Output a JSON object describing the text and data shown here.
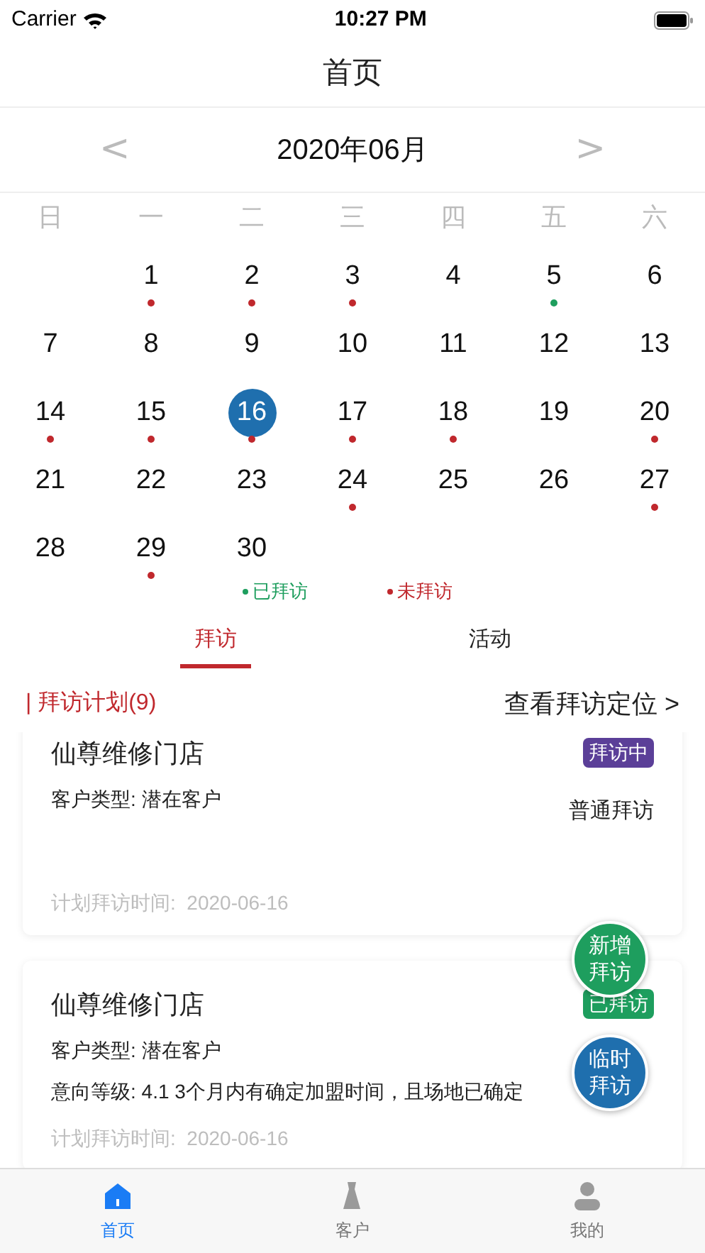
{
  "status_bar": {
    "carrier": "Carrier",
    "time": "10:27 PM"
  },
  "nav": {
    "title": "首页"
  },
  "calendar": {
    "month": "2020年06月",
    "prev": "<",
    "next": ">",
    "weekdays": [
      "日",
      "一",
      "二",
      "三",
      "四",
      "五",
      "六"
    ],
    "days": [
      {
        "kind": "blank"
      },
      {
        "kind": "day",
        "day": "1",
        "selected": false,
        "color": "#c0282d"
      },
      {
        "kind": "day",
        "day": "2",
        "selected": false,
        "color": "#c0282d"
      },
      {
        "kind": "day",
        "day": "3",
        "selected": false,
        "color": "#c0282d"
      },
      {
        "kind": "day",
        "day": "4",
        "selected": false
      },
      {
        "kind": "day",
        "day": "5",
        "selected": false,
        "color": "#1e9e5e"
      },
      {
        "kind": "day",
        "day": "6",
        "selected": false
      },
      {
        "kind": "day",
        "day": "7",
        "selected": false
      },
      {
        "kind": "day",
        "day": "8",
        "selected": false
      },
      {
        "kind": "day",
        "day": "9",
        "selected": false
      },
      {
        "kind": "day",
        "day": "10",
        "selected": false
      },
      {
        "kind": "day",
        "day": "11",
        "selected": false
      },
      {
        "kind": "day",
        "day": "12",
        "selected": false
      },
      {
        "kind": "day",
        "day": "13",
        "selected": false
      },
      {
        "kind": "day",
        "day": "14",
        "selected": false,
        "color": "#c0282d"
      },
      {
        "kind": "day",
        "day": "15",
        "selected": false,
        "color": "#c0282d"
      },
      {
        "kind": "day",
        "day": "16",
        "selected": true,
        "color": "#c0282d"
      },
      {
        "kind": "day",
        "day": "17",
        "selected": false,
        "color": "#c0282d"
      },
      {
        "kind": "day",
        "day": "18",
        "selected": false,
        "color": "#c0282d"
      },
      {
        "kind": "day",
        "day": "19",
        "selected": false
      },
      {
        "kind": "day",
        "day": "20",
        "selected": false,
        "color": "#c0282d"
      },
      {
        "kind": "day",
        "day": "21",
        "selected": false
      },
      {
        "kind": "day",
        "day": "22",
        "selected": false
      },
      {
        "kind": "day",
        "day": "23",
        "selected": false
      },
      {
        "kind": "day",
        "day": "24",
        "selected": false,
        "color": "#c0282d"
      },
      {
        "kind": "day",
        "day": "25",
        "selected": false
      },
      {
        "kind": "day",
        "day": "26",
        "selected": false
      },
      {
        "kind": "day",
        "day": "27",
        "selected": false,
        "color": "#c0282d"
      },
      {
        "kind": "day",
        "day": "28",
        "selected": false
      },
      {
        "kind": "day",
        "day": "29",
        "selected": false,
        "color": "#c0282d"
      },
      {
        "kind": "day",
        "day": "30",
        "selected": false
      }
    ],
    "legend": [
      {
        "label": "已拜访",
        "color": "#1e9e5e"
      },
      {
        "label": "未拜访",
        "color": "#c0282d"
      }
    ]
  },
  "tabs": [
    {
      "label": "拜访",
      "selected": true
    },
    {
      "label": "活动",
      "selected": false
    }
  ],
  "plan": {
    "title": "| 拜访计划(9)",
    "link": "查看拜访定位 >"
  },
  "cards": [
    {
      "name": "仙尊维修门店",
      "badge": {
        "label": "拜访中",
        "color": "#5b3f98"
      },
      "customer_type": "客户类型: 潜在客户",
      "visit_type": "普通拜访",
      "planned_time": "计划拜访时间:  2020-06-16"
    },
    {
      "name": "仙尊维修门店",
      "badge": {
        "label": "已拜访",
        "color": "#1e9e5e"
      },
      "customer_type": "客户类型: 潜在客户",
      "intent": "意向等级: 4.1 3个月内有确定加盟时间，且场地已确定",
      "planned_time": "计划拜访时间:  2020-06-16"
    }
  ],
  "fabs": [
    {
      "label": "新增拜访",
      "color": "#1e9e5e"
    },
    {
      "label": "临时拜访",
      "color": "#1f6fae"
    }
  ],
  "tab_bar": [
    {
      "label": "首页",
      "kind": "home",
      "selected": true
    },
    {
      "label": "客户",
      "kind": "customer",
      "selected": false
    },
    {
      "label": "我的",
      "kind": "me",
      "selected": false
    }
  ]
}
